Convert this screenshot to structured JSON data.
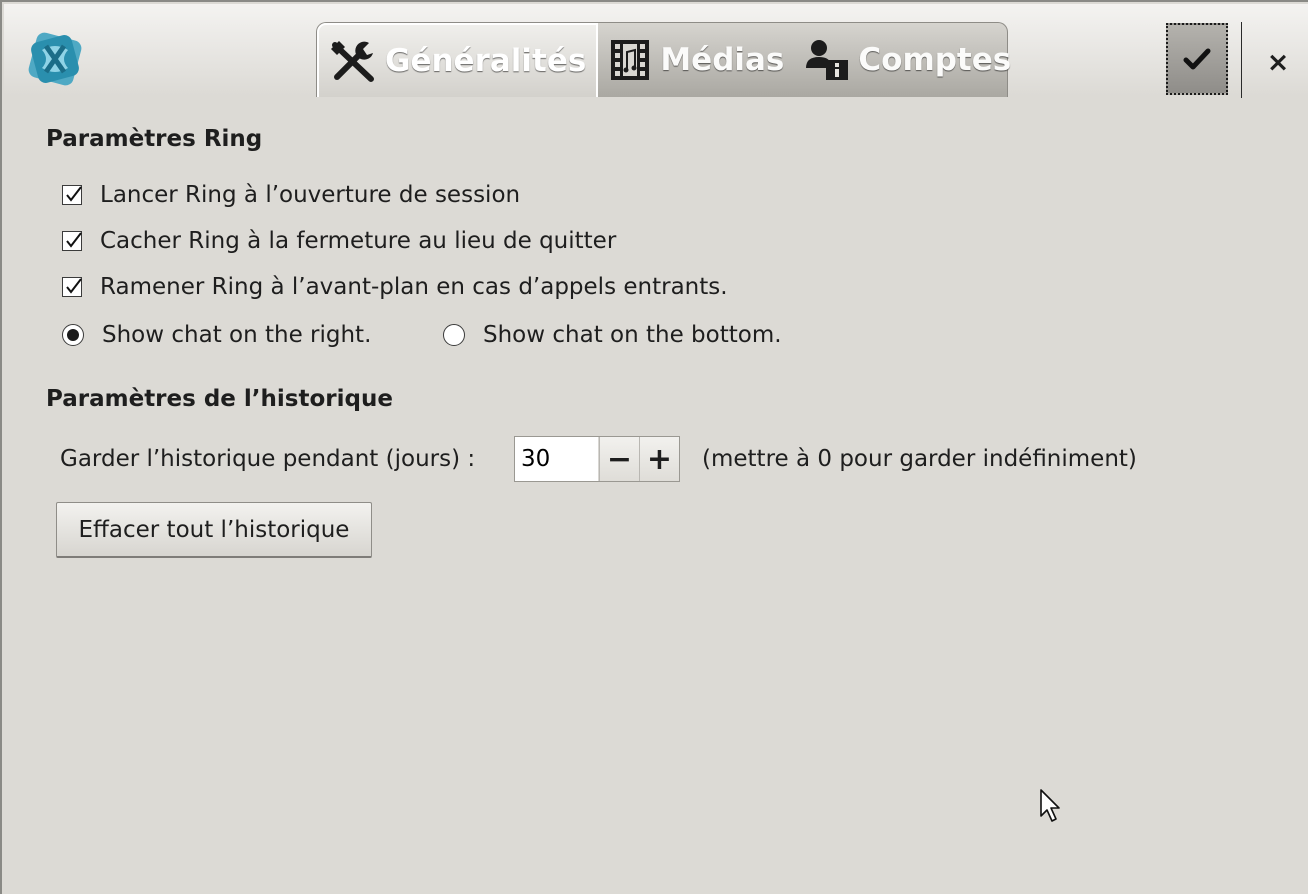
{
  "header": {
    "tabs": [
      {
        "label": "Généralités",
        "icon": "tools-icon",
        "active": true
      },
      {
        "label": "Médias",
        "icon": "film-music-icon",
        "active": false
      },
      {
        "label": "Comptes",
        "icon": "account-info-icon",
        "active": false
      }
    ],
    "apply_icon": "checkmark-icon",
    "close_label": "×"
  },
  "ring_settings": {
    "title": "Paramètres Ring",
    "options": [
      {
        "label": "Lancer Ring à l’ouverture de session",
        "checked": true
      },
      {
        "label": "Cacher Ring à la fermeture au lieu de quitter",
        "checked": true
      },
      {
        "label": "Ramener Ring à l’avant-plan en cas d’appels entrants.",
        "checked": true
      }
    ],
    "chat_position": {
      "right_label": "Show chat on the right.",
      "bottom_label": "Show chat on the bottom.",
      "selected": "right"
    }
  },
  "history_settings": {
    "title": "Paramètres de l’historique",
    "keep_label": "Garder l’historique pendant (jours) :",
    "keep_value": "30",
    "minus_label": "−",
    "plus_label": "+",
    "hint": "(mettre à 0 pour garder indéfiniment)",
    "clear_button": "Effacer tout l’historique"
  },
  "colors": {
    "background": "#dcdad5",
    "logo_teal": "#2a9fb8",
    "text": "#1e1e1e"
  }
}
